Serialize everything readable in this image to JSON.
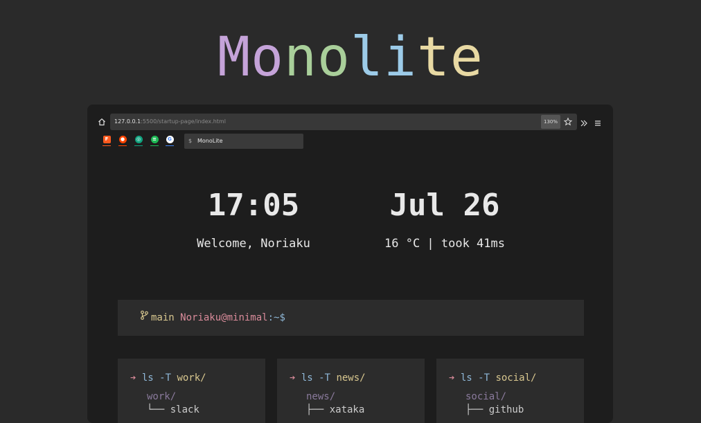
{
  "hero": {
    "letters": [
      {
        "ch": "M",
        "color": "#c5a3d9"
      },
      {
        "ch": "o",
        "color": "#c5a3d9"
      },
      {
        "ch": "n",
        "color": "#a9cf9a"
      },
      {
        "ch": "o",
        "color": "#a9cf9a"
      },
      {
        "ch": "l",
        "color": "#9ccbe8"
      },
      {
        "ch": "i",
        "color": "#9ccbe8"
      },
      {
        "ch": "t",
        "color": "#e8d9a3"
      },
      {
        "ch": "e",
        "color": "#e8d9a3"
      }
    ]
  },
  "browser": {
    "home_icon": "home-icon",
    "url_host": "127.0.0.1",
    "url_rest": ":5500/startup-page/index.html",
    "zoom": "130%",
    "star_icon": "star-icon",
    "overflow_icon": "chevron-double-right-icon",
    "menu_icon": "hamburger-menu-icon",
    "bookmarks": [
      {
        "name": "firefox-relay-icon",
        "color": "#ff5a1f",
        "glyph": "F"
      },
      {
        "name": "reddit-icon",
        "color": "#ff4500",
        "glyph": "●"
      },
      {
        "name": "chatgpt-icon",
        "color": "#10a37f",
        "glyph": "◎"
      },
      {
        "name": "spotify-icon",
        "color": "#1db954",
        "glyph": "≡"
      },
      {
        "name": "google-icon",
        "color": "#4285f4",
        "glyph": "G"
      }
    ],
    "tab": {
      "icon": "$",
      "label": "MonoLite"
    }
  },
  "dashboard": {
    "time": "17:05",
    "date": "Jul 26",
    "welcome": "Welcome, Noriaku",
    "weather": "16 °C | took 41ms"
  },
  "prompt": {
    "branch": "main",
    "user": "Noriaku@minimal",
    "path": ":~$",
    "colors": {
      "branch": "#d8c78f",
      "user": "#d98b9a",
      "path": "#8fb8d8"
    }
  },
  "cards": [
    {
      "cmd_arrow": "➔",
      "cmd": "ls -T",
      "target": "work/",
      "dir": "work/",
      "entry": "└── slack"
    },
    {
      "cmd_arrow": "➔",
      "cmd": "ls -T",
      "target": "news/",
      "dir": "news/",
      "entry": "├── xataka"
    },
    {
      "cmd_arrow": "➔",
      "cmd": "ls -T",
      "target": "social/",
      "dir": "social/",
      "entry": "├── github"
    }
  ],
  "colors": {
    "arrow": "#d98b9a",
    "cmd": "#8fb8d8",
    "target": "#d8c78f",
    "dir": "#8a7a9c",
    "entry": "#cccccc"
  }
}
